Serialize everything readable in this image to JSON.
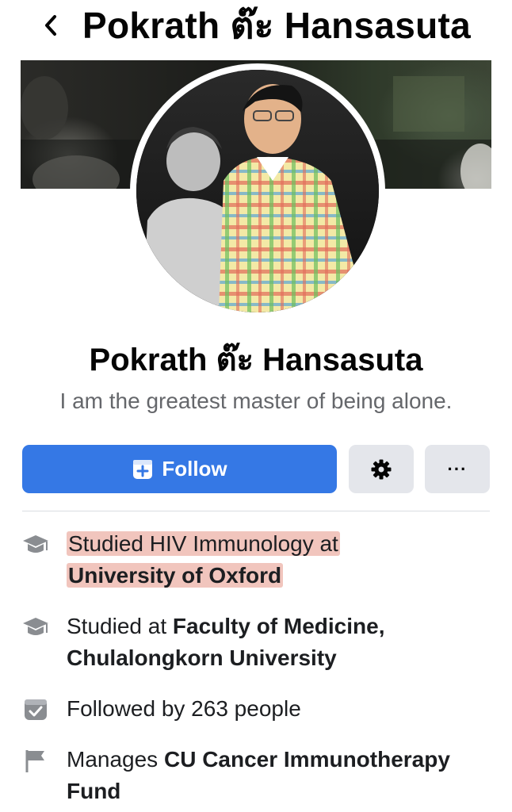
{
  "header": {
    "back_icon": "chevron-left-icon",
    "title": "Pokrath ต๊ะ Hansasuta"
  },
  "profile": {
    "name": "Pokrath ต๊ะ Hansasuta",
    "bio": "I am the greatest master of being alone."
  },
  "actions": {
    "follow_label": "Follow",
    "follow_icon": "follow-add-icon",
    "settings_icon": "gear-icon",
    "more_label": "···"
  },
  "intro": [
    {
      "icon": "graduation-cap-icon",
      "prefix": "Studied HIV Immunology at",
      "bold": "University of Oxford"
    },
    {
      "icon": "graduation-cap-icon",
      "prefix": "Studied at",
      "bold": "Faculty of Medicine, Chulalongkorn University"
    },
    {
      "icon": "followers-icon",
      "prefix": "Followed by 263 people",
      "bold": ""
    },
    {
      "icon": "flag-icon",
      "prefix": "Manages",
      "bold": "CU Cancer Immunotherapy Fund"
    }
  ],
  "colors": {
    "primary": "#3578e5",
    "secondary_button": "#e4e6eb",
    "muted_text": "#65676b",
    "highlight": "#e69687"
  }
}
